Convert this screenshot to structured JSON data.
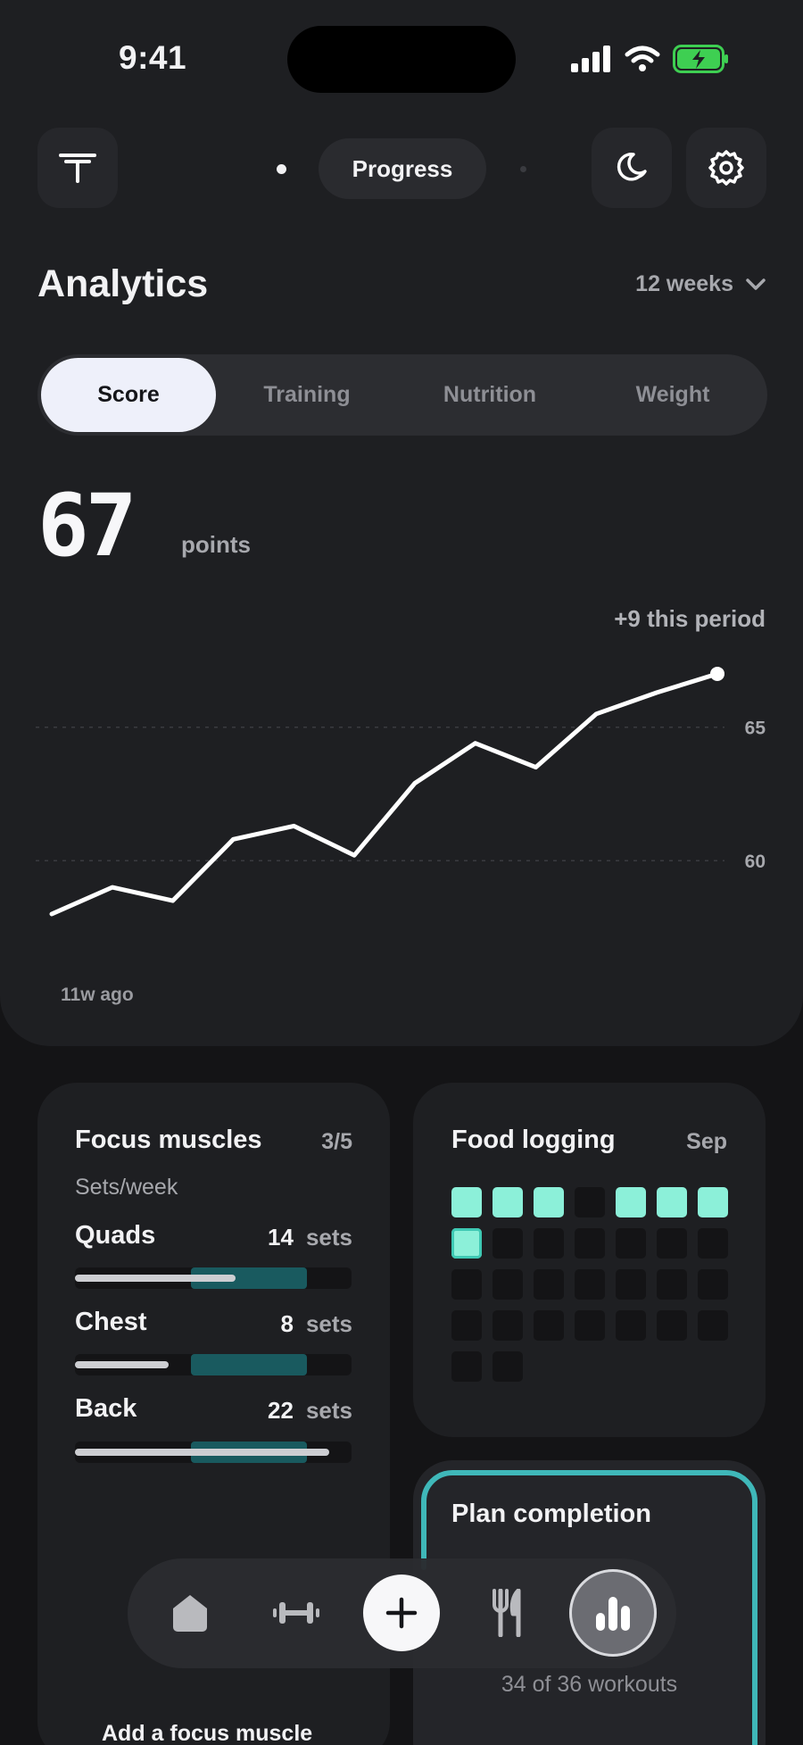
{
  "status_bar": {
    "time": "9:41"
  },
  "header": {
    "page_pill": "Progress"
  },
  "analytics": {
    "title": "Analytics",
    "period": "12 weeks",
    "tabs": [
      {
        "label": "Score",
        "active": true
      },
      {
        "label": "Training",
        "active": false
      },
      {
        "label": "Nutrition",
        "active": false
      },
      {
        "label": "Weight",
        "active": false
      }
    ],
    "score": "67",
    "score_unit": "points",
    "delta": "+9 this period"
  },
  "chart_data": {
    "type": "line",
    "title": "",
    "xlabel": "",
    "ylabel": "",
    "x_start_label": "11w ago",
    "ytick_labels": [
      "65",
      "60"
    ],
    "y_ticks": [
      65,
      60
    ],
    "ylim": [
      57.8,
      67.5
    ],
    "grid": true,
    "series": [
      {
        "values": [
          58.0,
          59.0,
          58.5,
          60.8,
          61.3,
          60.2,
          62.9,
          64.4,
          63.5,
          65.5,
          66.3,
          67.0
        ]
      }
    ],
    "colors": {
      "line": "#ffffff",
      "grid": "#3a3b40"
    }
  },
  "focus_muscles": {
    "title": "Focus muscles",
    "count": "3/5",
    "subtitle": "Sets/week",
    "unit_label": "sets",
    "items": [
      {
        "name": "Quads",
        "value": "14",
        "fill": 0.58,
        "target_start": 0.42,
        "target_end": 0.84
      },
      {
        "name": "Chest",
        "value": "8",
        "fill": 0.34,
        "target_start": 0.42,
        "target_end": 0.84
      },
      {
        "name": "Back",
        "value": "22",
        "fill": 0.92,
        "target_start": 0.42,
        "target_end": 0.84
      }
    ],
    "add_label": "Add a focus muscle"
  },
  "food_logging": {
    "title": "Food logging",
    "month": "Sep",
    "days": [
      1,
      1,
      1,
      0,
      1,
      1,
      1,
      2,
      0,
      0,
      0,
      0,
      0,
      0,
      0,
      0,
      0,
      0,
      0,
      0,
      0,
      0,
      0,
      0,
      0,
      0,
      0,
      0,
      0,
      0
    ],
    "colors": {
      "logged": "#8cf0d9",
      "empty": "#141416"
    }
  },
  "plan_completion": {
    "title": "Plan completion",
    "caption": "34 of 36 workouts",
    "completed": 34,
    "total": 36,
    "colors": {
      "ring": "#3fb8b9"
    }
  },
  "nav": {
    "items": [
      {
        "name": "home",
        "icon": "home-icon"
      },
      {
        "name": "workouts",
        "icon": "dumbbell-icon"
      },
      {
        "name": "add",
        "icon": "plus-icon"
      },
      {
        "name": "nutrition",
        "icon": "fork-knife-icon"
      },
      {
        "name": "analytics",
        "icon": "bar-chart-icon",
        "active": true
      }
    ]
  }
}
